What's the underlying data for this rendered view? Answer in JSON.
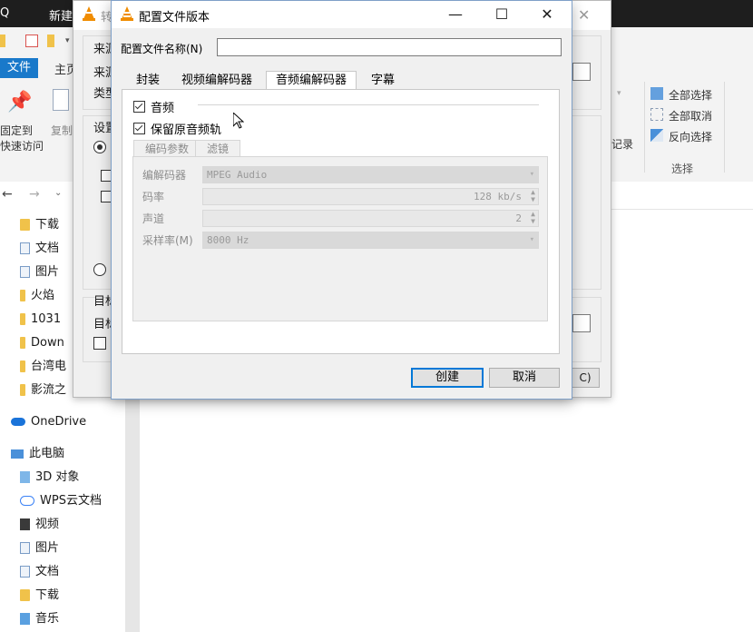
{
  "explorer": {
    "top_left": "Q",
    "top_new": "新建",
    "file_tab": "文件",
    "home_tab": "主页",
    "pin_label_1": "固定到",
    "pin_label_2": "快速访问",
    "copy_label": "复制",
    "select_all": "全部选择",
    "select_none": "全部取消",
    "invert_select": "反向选择",
    "select_group": "选择",
    "history_label": "记录",
    "nav_items": [
      {
        "label": "下载",
        "icon": "download-folder-icon"
      },
      {
        "label": "文档",
        "icon": "document-icon"
      },
      {
        "label": "图片",
        "icon": "picture-folder-icon"
      },
      {
        "label": "火焰",
        "icon": "folder-icon"
      },
      {
        "label": "1031",
        "icon": "folder-icon"
      },
      {
        "label": "Down",
        "icon": "folder-icon"
      },
      {
        "label": "台湾电",
        "icon": "folder-icon"
      },
      {
        "label": "影流之",
        "icon": "folder-icon"
      }
    ],
    "onedrive": "OneDrive",
    "this_pc": "此电脑",
    "pc_items": [
      {
        "label": "3D 对象",
        "icon": "3d-objects-icon"
      },
      {
        "label": "WPS云文档",
        "icon": "cloud-icon"
      },
      {
        "label": "视频",
        "icon": "video-folder-icon"
      },
      {
        "label": "图片",
        "icon": "picture-folder-icon"
      },
      {
        "label": "文档",
        "icon": "document-icon"
      },
      {
        "label": "下载",
        "icon": "download-folder-icon"
      },
      {
        "label": "音乐",
        "icon": "music-folder-icon"
      }
    ]
  },
  "bg_dialog": {
    "title_partial": "转",
    "labels": [
      "来源",
      "来源",
      "类型",
      "设置",
      "目标",
      "目标"
    ],
    "button_partial": "C)"
  },
  "dialog": {
    "title": "配置文件版本",
    "name_label": "配置文件名称(N)",
    "name_value": "",
    "tabs": [
      "封装",
      "视频编解码器",
      "音频编解码器",
      "字幕"
    ],
    "active_tab": 2,
    "audio_checkbox": {
      "label": "音频",
      "checked": true
    },
    "keep_track_checkbox": {
      "label": "保留原音频轨",
      "checked": true
    },
    "subtabs": [
      "编码参数",
      "滤镜"
    ],
    "params": {
      "codec_label": "编解码器",
      "codec_value": "MPEG Audio",
      "bitrate_label": "码率",
      "bitrate_value": "128 kb/s",
      "channels_label": "声道",
      "channels_value": "2",
      "samplerate_label": "采样率(M)",
      "samplerate_value": "8000 Hz"
    },
    "create_button": "创建",
    "cancel_button": "取消"
  }
}
